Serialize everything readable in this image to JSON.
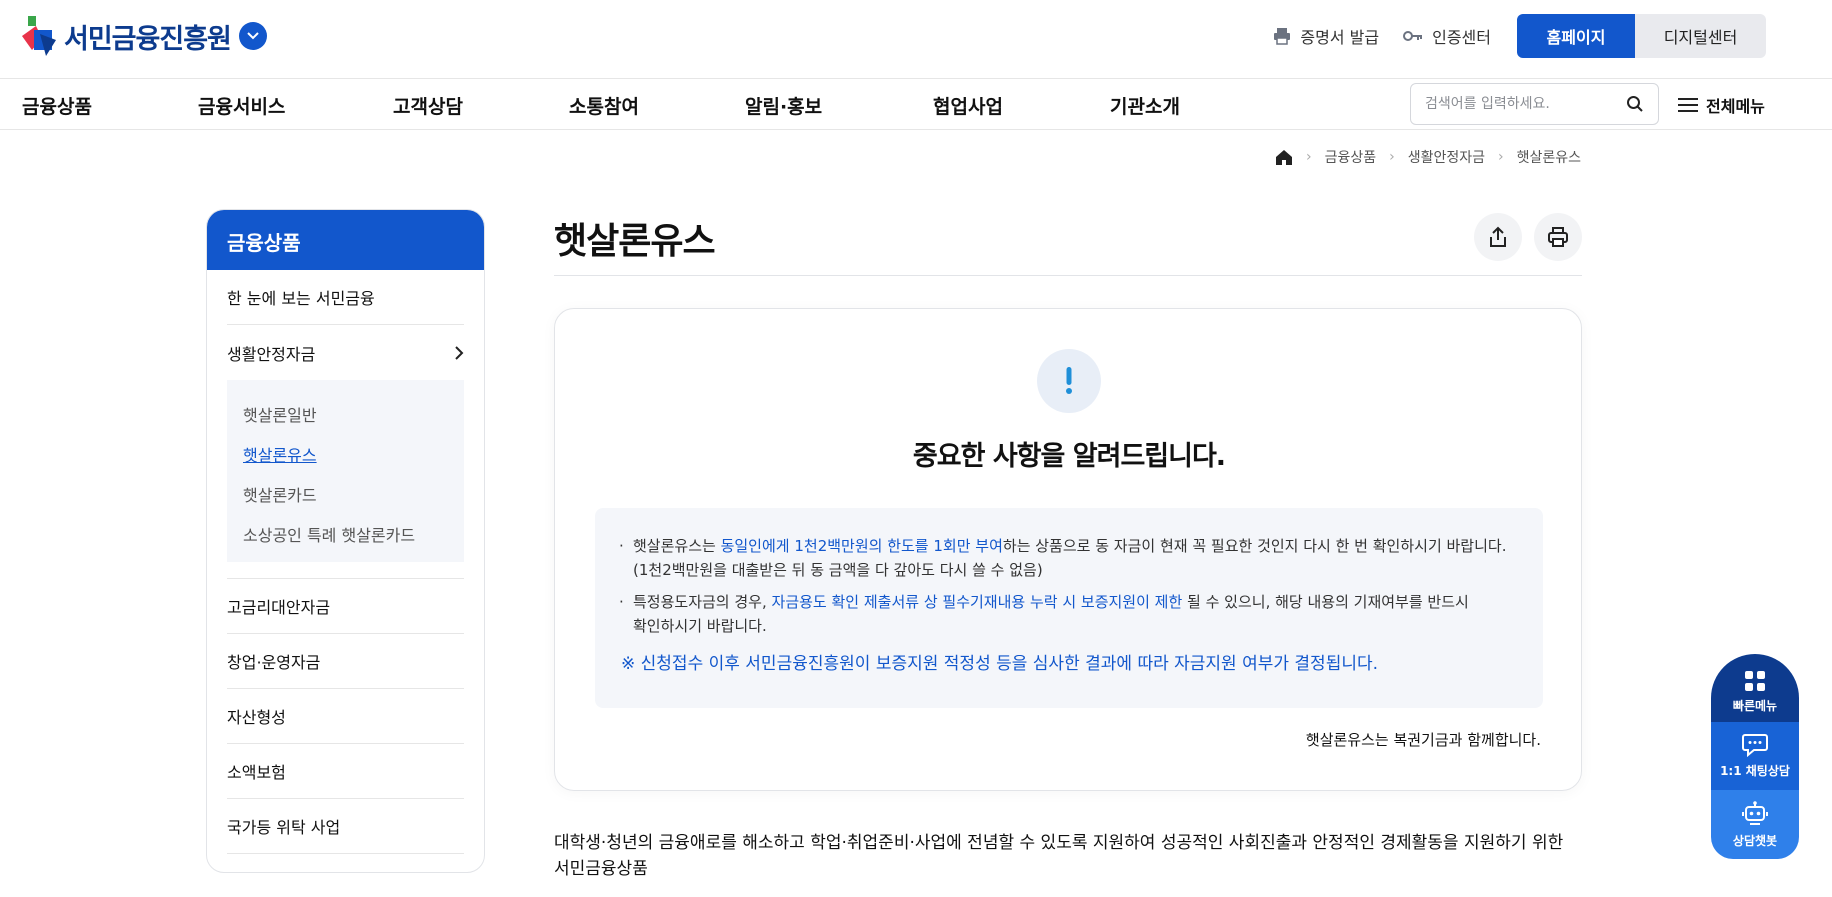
{
  "header": {
    "logo_text": "서민금융진흥원",
    "util_links": [
      {
        "label": "증명서 발급",
        "icon": "printer-icon"
      },
      {
        "label": "인증센터",
        "icon": "key-icon"
      }
    ],
    "site_tabs": [
      {
        "label": "홈페이지",
        "active": true
      },
      {
        "label": "디지털센터",
        "active": false
      }
    ]
  },
  "gnb": {
    "items": [
      "금융상품",
      "금융서비스",
      "고객상담",
      "소통참여",
      "알림·홍보",
      "협업사업",
      "기관소개"
    ],
    "search_placeholder": "검색어를 입력하세요.",
    "all_menu_label": "전체메뉴"
  },
  "breadcrumb": [
    "금융상품",
    "생활안정자금",
    "햇살론유스"
  ],
  "sidebar": {
    "title": "금융상품",
    "items": [
      "한 눈에 보는 서민금융",
      "생활안정자금",
      "고금리대안자금",
      "창업·운영자금",
      "자산형성",
      "소액보험",
      "국가등 위탁 사업"
    ],
    "sub_items": [
      "햇살론일반",
      "햇살론유스",
      "햇살론카드",
      "소상공인 특례 햇살론카드"
    ],
    "active_sub": "햇살론유스"
  },
  "page": {
    "title": "햇살론유스",
    "alert_title": "중요한 사항을 알려드립니다.",
    "notice_1_pre": "햇살론유스는 ",
    "notice_1_hl": "동일인에게 1천2백만원의 한도를 1회만 부여",
    "notice_1_post": "하는 상품으로 동 자금이 현재 꼭 필요한 것인지 다시 한 번 확인하시기 바랍니다.",
    "notice_1_line2": "(1천2백만원을 대출받은 뒤 동 금액을 다 갚아도 다시 쓸 수 없음)",
    "notice_2_pre": "특정용도자금의 경우, ",
    "notice_2_hl": "자금용도 확인 제출서류 상 필수기재내용 누락 시 보증지원이 제한",
    "notice_2_post": " 될 수 있으니, 해당 내용의 기재여부를 반드시",
    "notice_2_line2": "확인하시기 바랍니다.",
    "notice_big": "※ 신청접수 이후 서민금융진흥원이 보증지원 적정성 등을 심사한 결과에 따라 자금지원 여부가 결정됩니다.",
    "card_footer": "햇살론유스는 복권기금과 함께합니다.",
    "description": "대학생·청년의 금융애로를 해소하고 학업·취업준비·사업에 전념할 수 있도록 지원하여 성공적인 사회진출과 안정적인 경제활동을 지원하기 위한 서민금융상품"
  },
  "quick_menu": [
    {
      "label": "빠른메뉴",
      "icon": "grid-icon"
    },
    {
      "label": "1:1 채팅상담",
      "icon": "chat-icon"
    },
    {
      "label": "상담챗봇",
      "icon": "robot-icon"
    }
  ],
  "colors": {
    "primary": "#1257cc",
    "navy": "#0d3b8e",
    "panel": "#f4f6fa"
  }
}
